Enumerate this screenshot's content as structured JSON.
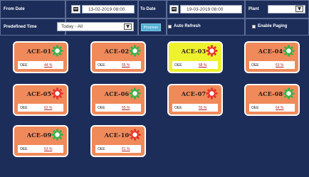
{
  "filters": {
    "from_date_label": "From Date",
    "from_date_value": "13-02-2019 08:00",
    "to_date_label": "To Date",
    "to_date_value": "19-03-2019 08:00",
    "plant_label": "Plant",
    "plant_value": "",
    "predefined_time_label": "Predefined Time",
    "predefined_time_value": "Today - All",
    "process_label": "Process",
    "auto_refresh_label": "Auto Refresh",
    "auto_refresh_checked": false,
    "enable_paging_label": "Enable Paging",
    "enable_paging_checked": false
  },
  "colors": {
    "background": "#1c2d5a",
    "card_default": "#f08a5a",
    "card_active": "#eef12e",
    "status_green": "#3bb34a",
    "status_red": "#e8352c",
    "process_button": "#56b1d6"
  },
  "cards": [
    {
      "name": "ACE-01",
      "metric": "OEE",
      "value": "44 %",
      "status": "green",
      "active": false
    },
    {
      "name": "ACE-02",
      "metric": "OEE",
      "value": "55 %",
      "status": "green",
      "active": false
    },
    {
      "name": "ACE-03",
      "metric": "OEE",
      "value": "68 %",
      "status": "red",
      "active": true
    },
    {
      "name": "ACE-04",
      "metric": "OEE",
      "value": "63 %",
      "status": "green",
      "active": false
    },
    {
      "name": "ACE-05",
      "metric": "OEE",
      "value": "62 %",
      "status": "red",
      "active": false
    },
    {
      "name": "ACE-06",
      "metric": "OEE",
      "value": "65 %",
      "status": "green",
      "active": false
    },
    {
      "name": "ACE-07",
      "metric": "OEE",
      "value": "55 %",
      "status": "red",
      "active": false
    },
    {
      "name": "ACE-08",
      "metric": "OEE",
      "value": "64 %",
      "status": "green",
      "active": false
    },
    {
      "name": "ACE-09",
      "metric": "OEE",
      "value": "63 %",
      "status": "green",
      "active": false
    },
    {
      "name": "ACE-10",
      "metric": "OEE",
      "value": "61 %",
      "status": "red",
      "active": false
    }
  ]
}
